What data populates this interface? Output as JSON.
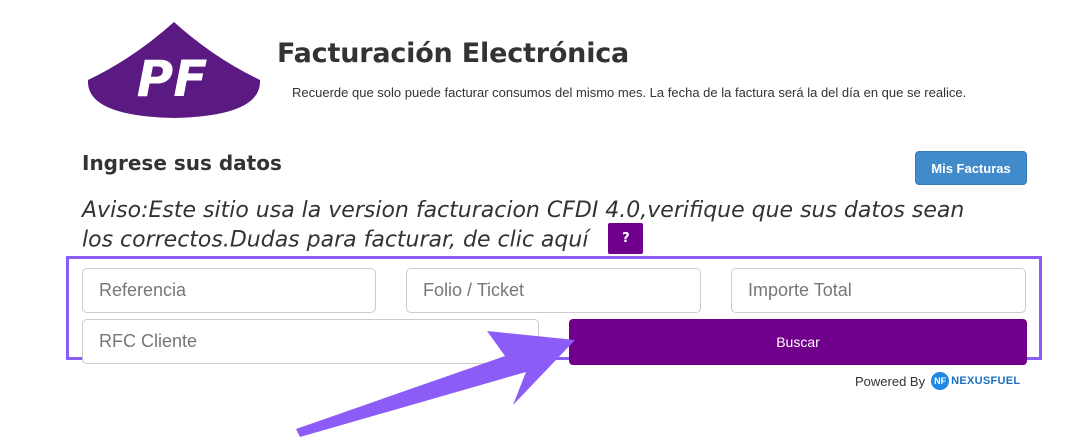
{
  "header": {
    "logo_icon": "pf-logo-icon",
    "title": "Facturación Electrónica",
    "notice": "Recuerde que solo puede facturar consumos del mismo mes. La fecha de la factura será la del día en que se realice."
  },
  "section": {
    "heading": "Ingrese sus datos",
    "mis_facturas_label": "Mis Facturas",
    "aviso": "Aviso:Este sitio usa la version facturacion CFDI 4.0,verifique que sus datos sean los correctos.Dudas para facturar, de clic aquí",
    "help_label": "?"
  },
  "form": {
    "referencia_placeholder": "Referencia",
    "folio_placeholder": "Folio / Ticket",
    "importe_placeholder": "Importe Total",
    "rfc_placeholder": "RFC Cliente",
    "buscar_label": "Buscar"
  },
  "footer": {
    "powered_by": "Powered By",
    "brand_mark": "NF",
    "brand_name": "NEXUSFUEL"
  },
  "colors": {
    "brand_purple": "#70008b",
    "primary_blue": "#428bca",
    "highlight": "#8b5cf6"
  }
}
